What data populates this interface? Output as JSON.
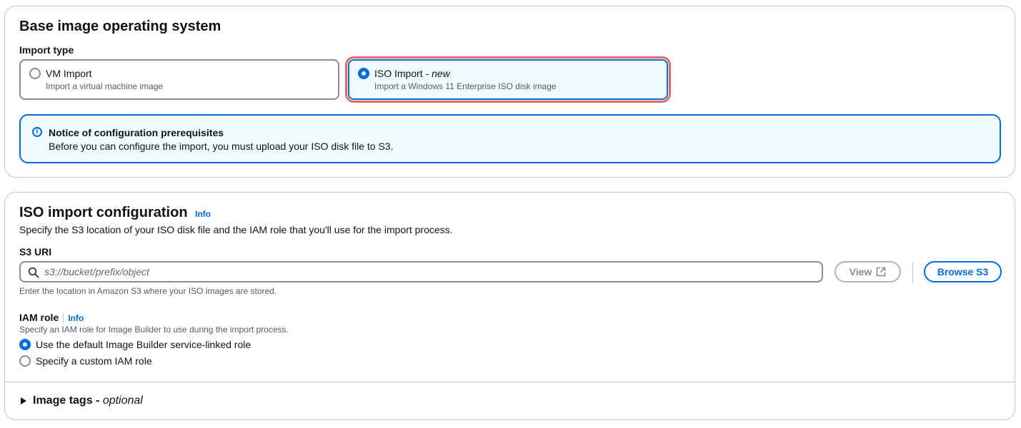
{
  "base_image": {
    "title": "Base image operating system",
    "import_type_label": "Import type",
    "options": [
      {
        "title": "VM Import",
        "title_suffix": "",
        "description": "Import a virtual machine image",
        "selected": false
      },
      {
        "title": "ISO Import - ",
        "title_suffix": "new",
        "description": "Import a Windows 11 Enterprise ISO disk image",
        "selected": true
      }
    ],
    "notice": {
      "title": "Notice of configuration prerequisites",
      "text": "Before you can configure the import, you must upload your ISO disk file to S3."
    }
  },
  "iso_config": {
    "title": "ISO import configuration",
    "info": "Info",
    "description": "Specify the S3 location of your ISO disk file and the IAM role that you'll use for the import process.",
    "s3_uri_label": "S3 URI",
    "s3_uri_placeholder": "s3://bucket/prefix/object",
    "s3_uri_value": "",
    "view_button": "View",
    "browse_button": "Browse S3",
    "s3_hint": "Enter the location in Amazon S3 where your ISO images are stored.",
    "iam_label": "IAM role",
    "iam_info": "Info",
    "iam_description": "Specify an IAM role for Image Builder to use during the import process.",
    "iam_options": [
      {
        "label": "Use the default Image Builder service-linked role",
        "selected": true
      },
      {
        "label": "Specify a custom IAM role",
        "selected": false
      }
    ],
    "tags_label": "Image tags - ",
    "tags_optional": "optional"
  },
  "colors": {
    "accent": "#006ce0",
    "highlight": "#e36a62"
  }
}
